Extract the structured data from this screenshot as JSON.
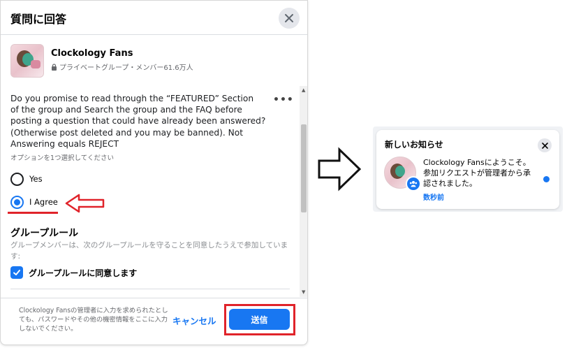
{
  "dialog": {
    "title": "質問に回答",
    "group": {
      "name": "Clockology Fans",
      "meta": "プライベートグループ・メンバー61.6万人"
    },
    "question": "Do you promise to read through the “FEATURED” Section\nof the group and Search the group and the FAQ before\nposting a question that could have already been answered?\n(Otherwise post deleted and you may be banned). Not\nAnswering equals REJECT",
    "more_label": "•••",
    "option_hint": "オプションを1つ選択してください",
    "options": [
      {
        "label": "Yes",
        "selected": false
      },
      {
        "label": "I Agree",
        "selected": true
      }
    ],
    "rules": {
      "title": "グループルール",
      "description": "グループメンバーは、次のグループルールを守ることを同意したうえで参加しています:",
      "agree_label": "グループルールに同意します",
      "agreed": true
    },
    "footer": {
      "note": "Clockology Fansの管理者に入力を求められたとしても、パスワードやその他の機密情報をここに入力しないでください。",
      "cancel_label": "キャンセル",
      "send_label": "送信"
    }
  },
  "notification": {
    "title": "新しいお知らせ",
    "text": "Clockology Fansにようこそ。参加リクエストが管理者から承認されました。",
    "time": "数秒前",
    "unread": true
  },
  "colors": {
    "accent": "#1877f2",
    "annotation_red": "#e0232a"
  },
  "icons": {
    "close": "close-icon",
    "lock": "lock-icon",
    "checkmark": "checkmark-icon",
    "groups_badge": "groups-icon",
    "arrow_left": "left-arrow-annotation",
    "arrow_right": "right-arrow-annotation"
  }
}
